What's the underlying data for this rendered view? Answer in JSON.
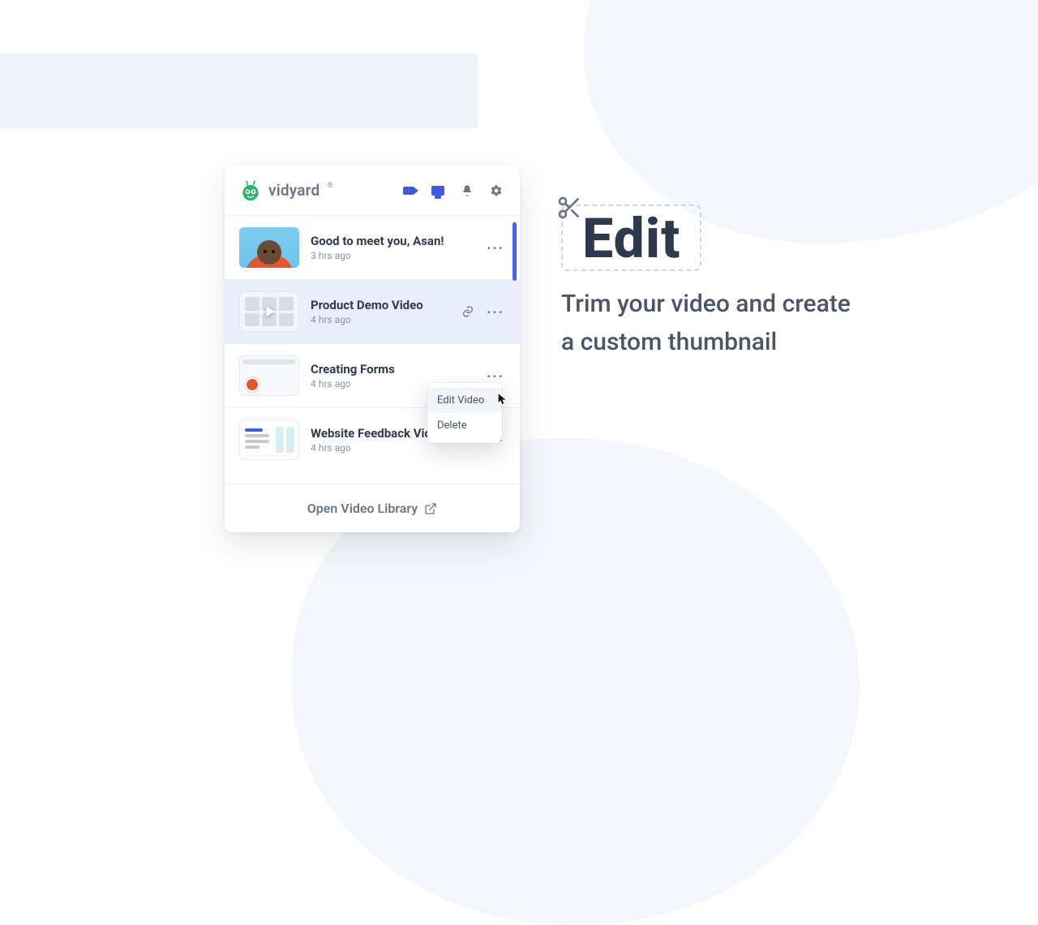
{
  "brand": {
    "name": "vidyard"
  },
  "header": {
    "icons": {
      "camera": "camera-icon",
      "screen": "screen-icon",
      "notifications": "bell-icon",
      "settings": "gear-icon"
    }
  },
  "videos": [
    {
      "title": "Good to meet you, Asan!",
      "time": "3 hrs ago"
    },
    {
      "title": "Product Demo Video",
      "time": "4 hrs ago"
    },
    {
      "title": "Creating Forms",
      "time": "4 hrs ago"
    },
    {
      "title": "Website Feedback Video",
      "time": "4 hrs ago"
    }
  ],
  "menu": {
    "edit": "Edit Video",
    "delete": "Delete"
  },
  "footer": {
    "label": "Open Video Library"
  },
  "feature": {
    "heading": "Edit",
    "subtitle": "Trim your video and create a custom thumbnail"
  }
}
